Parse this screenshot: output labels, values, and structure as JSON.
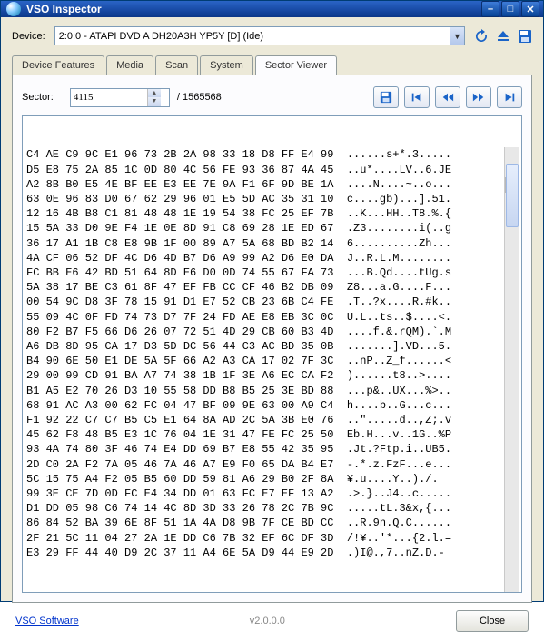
{
  "window": {
    "title": "VSO Inspector"
  },
  "device": {
    "label": "Device:",
    "value": "2:0:0 - ATAPI DVD A  DH20A3H YP5Y [D] (Ide)"
  },
  "tabs": [
    {
      "label": "Device Features"
    },
    {
      "label": "Media"
    },
    {
      "label": "Scan"
    },
    {
      "label": "System"
    },
    {
      "label": "Sector Viewer"
    }
  ],
  "active_tab": 4,
  "sector": {
    "label": "Sector:",
    "value": "4115",
    "total": "/ 1565568"
  },
  "icons": {
    "app": "vso-icon",
    "minimize": "minimize-icon",
    "maximize": "maximize-icon",
    "close": "close-icon",
    "refresh": "refresh-icon",
    "eject": "eject-icon",
    "save": "save-icon",
    "nav_save": "save-sector-icon",
    "first": "first-icon",
    "prev": "prev-icon",
    "next": "next-icon",
    "last": "last-icon"
  },
  "hex_rows": [
    "C4 AE C9 9C E1 96 73 2B 2A 98 33 18 D8 FF E4 99  ......s+*.3.....",
    "D5 E8 75 2A 85 1C 0D 80 4C 56 FE 93 36 87 4A 45  ..u*....LV..6.JE",
    "A2 8B B0 E5 4E BF EE E3 EE 7E 9A F1 6F 9D BE 1A  ....N....~..o...",
    "63 0E 96 83 D0 67 62 29 96 01 E5 5D AC 35 31 10  c....gb)...].51.",
    "12 16 4B B8 C1 81 48 48 1E 19 54 38 FC 25 EF 7B  ..K...HH..T8.%.{",
    "15 5A 33 D0 9E F4 1E 0E 8D 91 C8 69 28 1E ED 67  .Z3........i(..g",
    "36 17 A1 1B C8 E8 9B 1F 00 89 A7 5A 68 BD B2 14  6..........Zh...",
    "4A CF 06 52 DF 4C D6 4D B7 D6 A9 99 A2 D6 E0 DA  J..R.L.M........",
    "FC BB E6 42 BD 51 64 8D E6 D0 0D 74 55 67 FA 73  ...B.Qd....tUg.s",
    "5A 38 17 BE C3 61 8F 47 EF FB CC CF 46 B2 DB 09  Z8...a.G....F...",
    "00 54 9C D8 3F 78 15 91 D1 E7 52 CB 23 6B C4 FE  .T..?x....R.#k..",
    "55 09 4C 0F FD 74 73 D7 7F 24 FD AE E8 EB 3C 0C  U.L..ts..$....<.",
    "80 F2 B7 F5 66 D6 26 07 72 51 4D 29 CB 60 B3 4D  ....f.&.rQM).`.M",
    "A6 DB 8D 95 CA 17 D3 5D DC 56 44 C3 AC BD 35 0B  .......].VD...5.",
    "B4 90 6E 50 E1 DE 5A 5F 66 A2 A3 CA 17 02 7F 3C  ..nP..Z_f......<",
    "29 00 99 CD 91 BA A7 74 38 1B 1F 3E A6 EC CA F2  )......t8..>....",
    "B1 A5 E2 70 26 D3 10 55 58 DD B8 B5 25 3E BD 88  ...p&..UX...%>..",
    "68 91 AC A3 00 62 FC 04 47 BF 09 9E 63 00 A9 C4  h....b..G...c...",
    "F1 92 22 C7 C7 B5 C5 E1 64 8A AD 2C 5A 3B E0 76  ..\".....d..,Z;.v",
    "45 62 F8 48 B5 E3 1C 76 04 1E 31 47 FE FC 25 50  Eb.H...v..1G..%P",
    "93 4A 74 80 3F 46 74 E4 DD 69 B7 E8 55 42 35 95  .Jt.?Ftp.i..UB5.",
    "2D C0 2A F2 7A 05 46 7A 46 A7 E9 F0 65 DA B4 E7  -.*.z.FzF...e...",
    "5C 15 75 A4 F2 05 B5 60 DD 59 81 A6 29 B0 2F 8A  ¥.u....Y..)./.",
    "99 3E CE 7D 0D FC E4 34 DD 01 63 FC E7 EF 13 A2  .>.}..J4..c.....",
    "D1 DD 05 98 C6 74 14 4C 8D 3D 33 26 78 2C 7B 9C  .....tL.3&x,{...",
    "86 84 52 BA 39 6E 8F 51 1A 4A D8 9B 7F CE BD CC  ..R.9n.Q.C......",
    "2F 21 5C 11 04 27 2A 1E DD C6 7B 32 EF 6C DF 3D  /!¥..'*...{2.l.=",
    "E3 29 FF 44 40 D9 2C 37 11 A4 6E 5A D9 44 E9 2D  .)I@.,7..nZ.D.-"
  ],
  "footer": {
    "link": "VSO Software",
    "version": "v2.0.0.0",
    "close": "Close"
  }
}
